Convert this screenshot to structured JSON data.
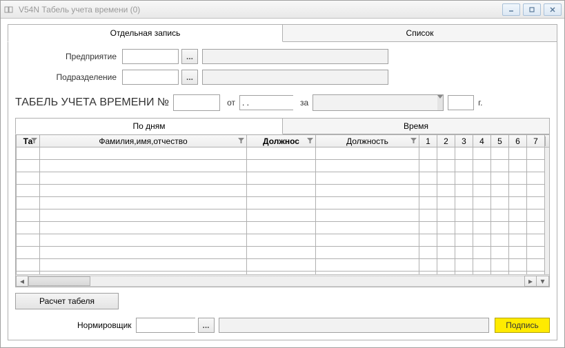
{
  "window": {
    "title": "V54N Табель учета времени (0)"
  },
  "main_tabs": {
    "single": "Отдельная запись",
    "list": "Список"
  },
  "form": {
    "enterprise_label": "Предприятие",
    "department_label": "Подразделение"
  },
  "header": {
    "title": "ТАБЕЛЬ УЧЕТА ВРЕМЕНИ №",
    "from_label": "от",
    "date_value": ". .",
    "for_label": "за",
    "year_suffix": "г."
  },
  "sub_tabs": {
    "by_days": "По дням",
    "time": "Время"
  },
  "grid": {
    "columns": {
      "ta": "Та",
      "fio": "Фамилия,имя,отчество",
      "position_code": "Должнос",
      "position": "Должность",
      "days": [
        "1",
        "2",
        "3",
        "4",
        "5",
        "6",
        "7"
      ]
    }
  },
  "buttons": {
    "calc": "Расчет табеля",
    "ellipsis": "...",
    "sign": "Подпись"
  },
  "sign": {
    "label": "Нормировщик"
  }
}
